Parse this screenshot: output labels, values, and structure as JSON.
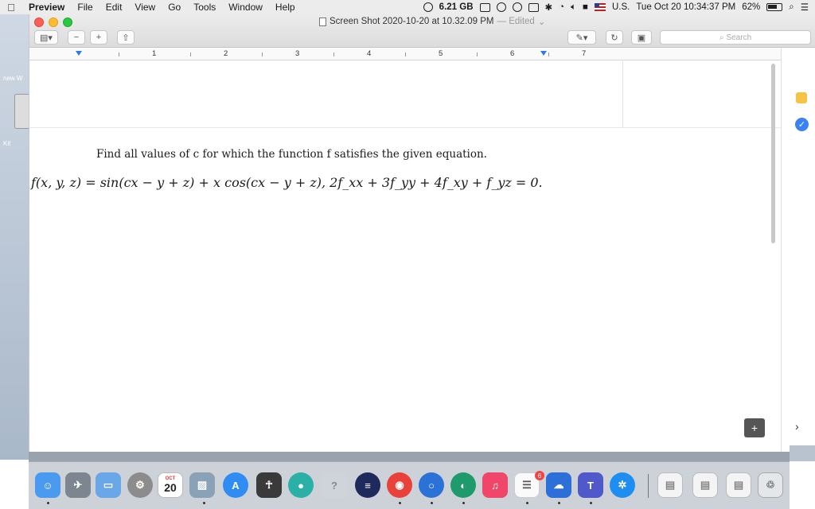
{
  "menubar": {
    "app": "Preview",
    "items": [
      "File",
      "Edit",
      "View",
      "Go",
      "Tools",
      "Window",
      "Help"
    ],
    "storage": "6.21 GB",
    "keyboard": "U.S.",
    "datetime": "Tue Oct 20  10:34:37 PM",
    "battery": "62%"
  },
  "window": {
    "title": "Screen Shot 2020-10-20 at 10.32.09 PM",
    "edited": "— Edited",
    "search_placeholder": "Search"
  },
  "ruler": {
    "numbers": [
      "1",
      "2",
      "3",
      "4",
      "5",
      "6",
      "7"
    ]
  },
  "document": {
    "problem": "Find all values of c for which the function f satisfies the given equation.",
    "equation": "f(x, y, z) = sin(cx − y + z) + x cos(cx − y + z),  2f_xx + 3f_yy + 4f_xy + f_yz = 0."
  },
  "desktop": {
    "left_label_1": "new W",
    "left_label_2": "Kit"
  },
  "dock": {
    "calendar_month": "OCT",
    "calendar_day": "20",
    "badge_count": "6",
    "teams_letter": "T"
  },
  "colors": {
    "accent": "#2b7be4",
    "menubar": "#ececec",
    "titlebar": "#e4e4e4"
  }
}
